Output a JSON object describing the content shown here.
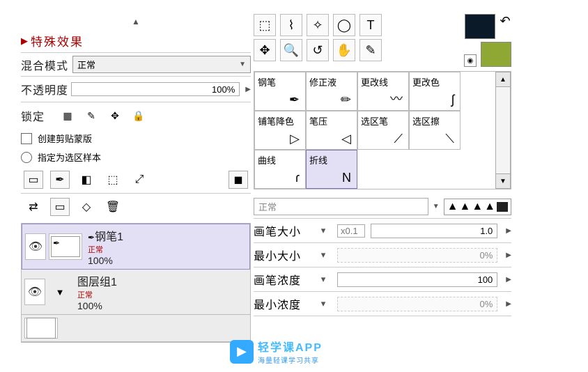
{
  "left": {
    "fx_title": "特殊效果",
    "blend_label": "混合模式",
    "blend_value": "正常",
    "opacity_label": "不透明度",
    "opacity_value": "100%",
    "lock_label": "锁定",
    "clip_label": "创建剪贴蒙版",
    "sample_label": "指定为选区样本",
    "layers": [
      {
        "name": "钢笔1",
        "mode": "正常",
        "opacity": "100%"
      },
      {
        "name": "图层组1",
        "mode": "正常",
        "opacity": "100%"
      }
    ]
  },
  "right": {
    "cats": [
      [
        "钢笔",
        "修正液",
        "更改线",
        "更改色"
      ],
      [
        "铺笔降色",
        "笔压",
        "选区笔",
        "选区擦"
      ],
      [
        "曲线",
        "折线",
        "",
        ""
      ]
    ],
    "brush_mode": "正常",
    "settings": [
      {
        "label": "画笔大小",
        "x": "x0.1",
        "value": "1.0"
      },
      {
        "label": "最小大小",
        "value": "0%",
        "pct": true
      },
      {
        "label": "画笔浓度",
        "value": "100"
      },
      {
        "label": "最小浓度",
        "value": "0%",
        "pct": true
      }
    ]
  },
  "watermark": {
    "brand": "轻学课APP",
    "sub": "海量轻课学习共享"
  }
}
